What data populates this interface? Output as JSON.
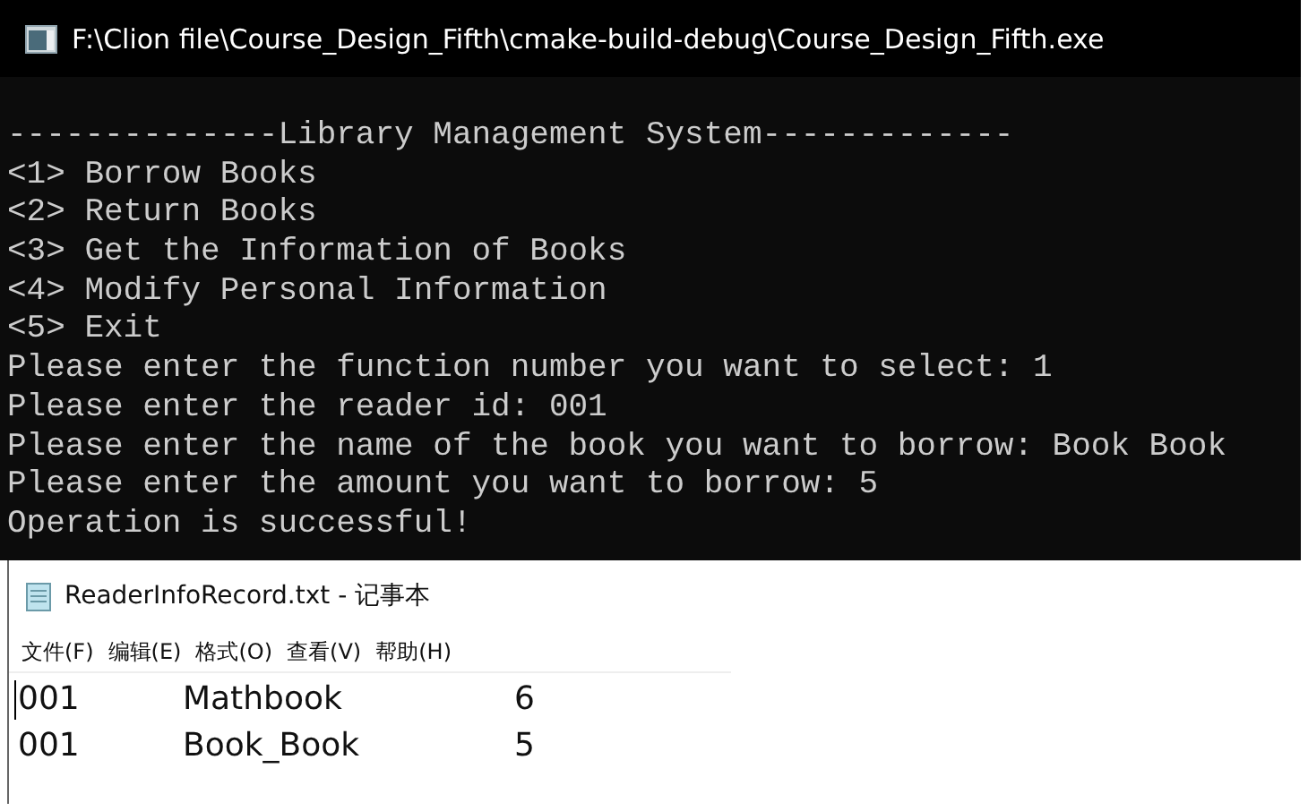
{
  "console_window": {
    "title": "F:\\Clion file\\Course_Design_Fifth\\cmake-build-debug\\Course_Design_Fifth.exe",
    "lines": [
      "--------------Library Management System-------------",
      "<1> Borrow Books",
      "<2> Return Books",
      "<3> Get the Information of Books",
      "<4> Modify Personal Information",
      "<5> Exit",
      "Please enter the function number you want to select: 1",
      "Please enter the reader id: 001",
      "Please enter the name of the book you want to borrow: Book Book",
      "Please enter the amount you want to borrow: 5",
      "Operation is successful!"
    ]
  },
  "notepad_window": {
    "title": "ReaderInfoRecord.txt - 记事本",
    "menu": [
      "文件(F)",
      "编辑(E)",
      "格式(O)",
      "查看(V)",
      "帮助(H)"
    ],
    "rows": [
      [
        "001",
        "Mathbook",
        "6"
      ],
      [
        "001",
        "Book_Book",
        "5"
      ]
    ]
  }
}
